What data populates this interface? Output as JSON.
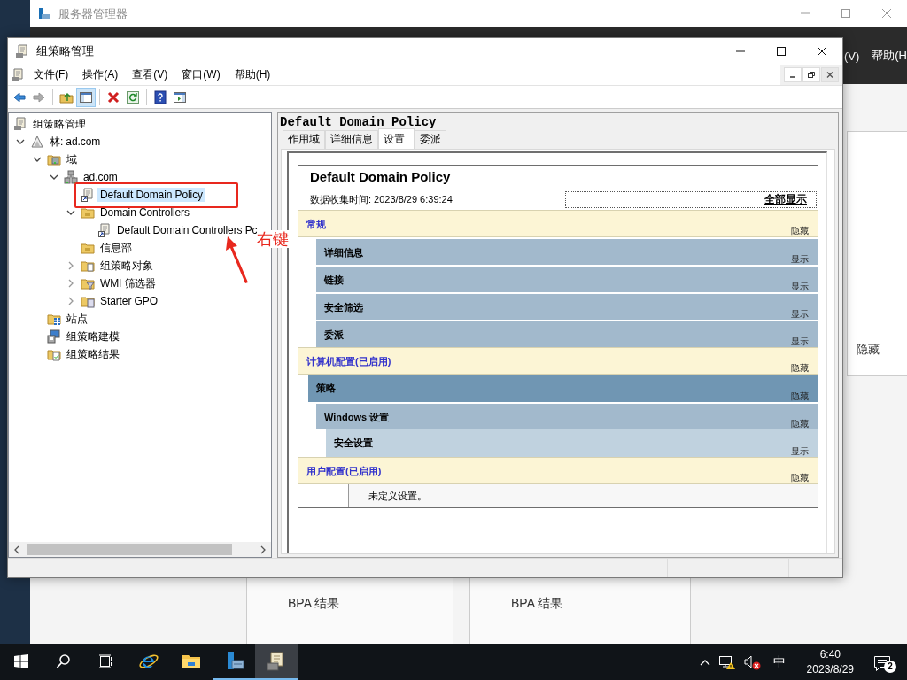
{
  "background_window": {
    "title": "服务器管理器",
    "menu": [
      "(V)",
      "帮助(H"
    ],
    "side_link": "隐藏",
    "tiles": [
      {
        "items": [
          "BPA 结果"
        ]
      },
      {
        "items": [
          "BPA 结果"
        ]
      }
    ]
  },
  "window": {
    "title": "组策略管理",
    "menu": [
      "文件(F)",
      "操作(A)",
      "查看(V)",
      "窗口(W)",
      "帮助(H)"
    ],
    "toolbar": [
      [
        {
          "kind": "back",
          "disabled": false,
          "pressed": false
        },
        {
          "kind": "forward",
          "disabled": true,
          "pressed": false
        }
      ],
      [
        {
          "kind": "up",
          "disabled": false,
          "pressed": false
        },
        {
          "kind": "tree",
          "disabled": false,
          "pressed": true
        }
      ],
      [
        {
          "kind": "delete",
          "disabled": false,
          "pressed": false
        },
        {
          "kind": "refresh",
          "disabled": false,
          "pressed": false
        }
      ],
      [
        {
          "kind": "help",
          "disabled": false,
          "pressed": false
        },
        {
          "kind": "panel",
          "disabled": false,
          "pressed": false
        }
      ]
    ],
    "tree": [
      {
        "kind": "console",
        "label": "组策略管理",
        "selected": false,
        "children": [
          {
            "kind": "forest",
            "label": "林: ad.com",
            "selected": false,
            "expanded": true,
            "children": [
              {
                "kind": "domains",
                "label": "域",
                "selected": false,
                "expanded": true,
                "children": [
                  {
                    "kind": "domain",
                    "label": "ad.com",
                    "selected": false,
                    "expanded": true,
                    "children": [
                      {
                        "kind": "gpo",
                        "label": "Default Domain Policy",
                        "selected": true
                      },
                      {
                        "kind": "ou",
                        "label": "Domain Controllers",
                        "selected": false,
                        "expanded": true,
                        "children": [
                          {
                            "kind": "gpo",
                            "label": "Default Domain Controllers Pc",
                            "selected": false
                          }
                        ]
                      },
                      {
                        "kind": "ou",
                        "label": "信息部",
                        "selected": false
                      },
                      {
                        "kind": "gpos",
                        "label": "组策略对象",
                        "selected": false,
                        "expanded": false
                      },
                      {
                        "kind": "wmi",
                        "label": "WMI 筛选器",
                        "selected": false,
                        "expanded": false
                      },
                      {
                        "kind": "starter",
                        "label": "Starter GPO",
                        "selected": false,
                        "expanded": false
                      }
                    ]
                  }
                ]
              },
              {
                "kind": "sites",
                "label": "站点",
                "selected": false
              },
              {
                "kind": "modeling",
                "label": "组策略建模",
                "selected": false
              },
              {
                "kind": "results",
                "label": "组策略结果",
                "selected": false
              }
            ]
          }
        ]
      }
    ],
    "pane": {
      "title": "Default Domain Policy",
      "tabs": [
        {
          "label": "作用域",
          "selected": false
        },
        {
          "label": "详细信息",
          "selected": false
        },
        {
          "label": "设置",
          "selected": true
        },
        {
          "label": "委派",
          "selected": false
        }
      ],
      "report": {
        "title": "Default Domain Policy",
        "collected": "数据收集时间: 2023/8/29 6:39:24",
        "show_all": "全部显示",
        "sections": [
          {
            "kind": "section",
            "label": "常规",
            "toggle": "隐藏",
            "children": [
              {
                "kind": "group",
                "label": "详细信息",
                "toggle": "显示"
              },
              {
                "kind": "group",
                "label": "链接",
                "toggle": "显示"
              },
              {
                "kind": "group",
                "label": "安全筛选",
                "toggle": "显示"
              },
              {
                "kind": "group",
                "label": "委派",
                "toggle": "显示"
              }
            ]
          },
          {
            "kind": "section",
            "label": "计算机配置(已启用)",
            "toggle": "隐藏",
            "children": [
              {
                "kind": "policy",
                "label": "策略",
                "toggle": "隐藏",
                "children": [
                  {
                    "kind": "group",
                    "label": "Windows 设置",
                    "toggle": "隐藏",
                    "children": [
                      {
                        "kind": "subgroup",
                        "label": "安全设置",
                        "toggle": "显示"
                      }
                    ]
                  }
                ]
              }
            ]
          },
          {
            "kind": "section",
            "label": "用户配置(已启用)",
            "toggle": "隐藏",
            "note": "未定义设置。"
          }
        ]
      }
    }
  },
  "annotation": {
    "label": "右键"
  },
  "taskbar": {
    "apps": [
      {
        "kind": "start",
        "running": false,
        "active": false
      },
      {
        "kind": "search",
        "running": false,
        "active": false
      },
      {
        "kind": "taskview",
        "running": false,
        "active": false
      },
      {
        "kind": "browser",
        "running": false,
        "active": false
      },
      {
        "kind": "explorer",
        "running": false,
        "active": false
      },
      {
        "kind": "servermanager",
        "running": true,
        "active": false
      },
      {
        "kind": "gpmc",
        "running": true,
        "active": true
      }
    ],
    "ime": "中",
    "time": "6:40",
    "date": "2023/8/29",
    "notifications": "2"
  }
}
